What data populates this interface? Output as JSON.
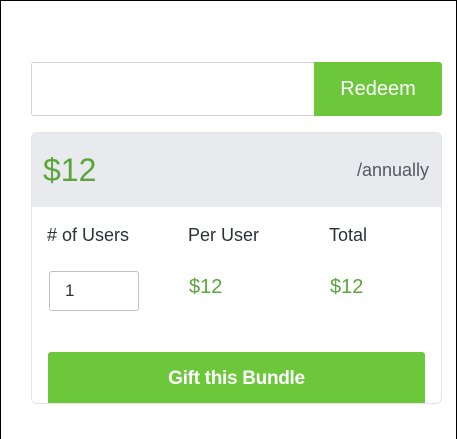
{
  "redeem": {
    "input_value": "",
    "button_label": "Redeem"
  },
  "pricing": {
    "price": "$12",
    "period": "/annually",
    "columns": {
      "users_label": "# of Users",
      "per_user_label": "Per User",
      "total_label": "Total"
    },
    "quantity": "1",
    "per_user_value": "$12",
    "total_value": "$12"
  },
  "gift_button_label": "Gift this Bundle",
  "colors": {
    "accent_green": "#6cc73a",
    "price_green": "#59a73b",
    "header_bg": "#e9eaee"
  }
}
